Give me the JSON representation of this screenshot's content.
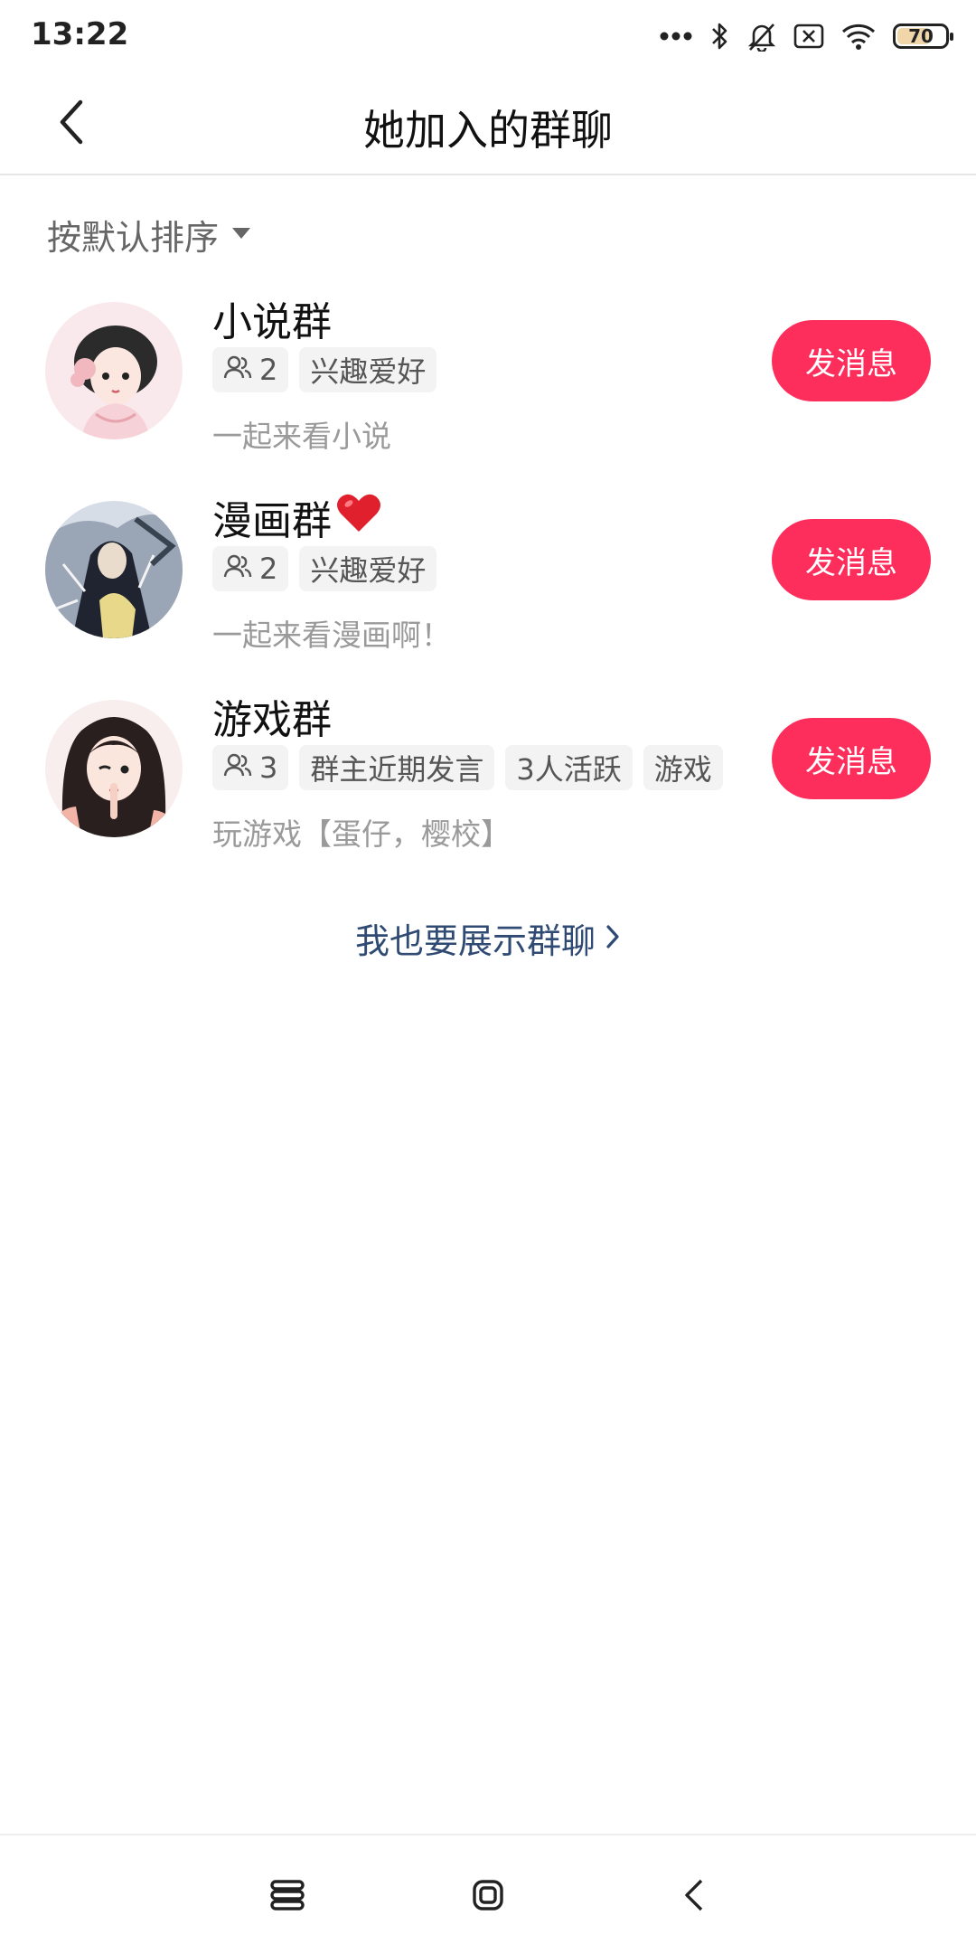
{
  "status_bar": {
    "time": "13:22",
    "battery": "70",
    "battery_level_percent": 70,
    "icons": [
      "more-dots-icon",
      "bluetooth-icon",
      "mute-bell-icon",
      "sim-off-icon",
      "wifi-icon",
      "battery-icon"
    ]
  },
  "header": {
    "title": "她加入的群聊",
    "back_icon": "back-arrow-icon"
  },
  "sort": {
    "label": "按默认排序",
    "icon": "caret-down-icon"
  },
  "groups": [
    {
      "name": "小说群",
      "name_emoji": "",
      "member_count": "2",
      "tags": [
        "兴趣爱好"
      ],
      "description": "一起来看小说",
      "button_label": "发消息",
      "avatar_colors": [
        "#f7dfe3",
        "#2b2b2b",
        "#f2b8c0"
      ]
    },
    {
      "name": "漫画群",
      "name_emoji": "❤️",
      "member_count": "2",
      "tags": [
        "兴趣爱好"
      ],
      "description": "一起来看漫画啊！",
      "button_label": "发消息",
      "avatar_colors": [
        "#cfd6e0",
        "#1f2430",
        "#e8d98a"
      ]
    },
    {
      "name": "游戏群",
      "name_emoji": "",
      "member_count": "3",
      "tags": [
        "群主近期发言",
        "3人活跃",
        "游戏"
      ],
      "description": "玩游戏【蛋仔，樱校】",
      "button_label": "发消息",
      "avatar_colors": [
        "#f6e6e6",
        "#2a1f1f",
        "#f3b4a8"
      ]
    }
  ],
  "show_groups_link": {
    "label": "我也要展示群聊",
    "icon": "chevron-right-icon"
  },
  "nav_bar": {
    "icons": [
      "menu-icon",
      "home-icon",
      "back-icon"
    ]
  },
  "colors": {
    "accent": "#fd2d5c",
    "link": "#2f4a73",
    "tag_bg": "#f3f3f3",
    "muted_text": "#9a9a9a"
  }
}
